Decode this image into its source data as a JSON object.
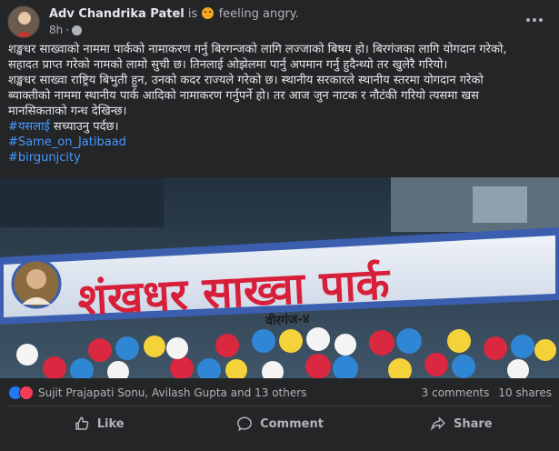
{
  "post": {
    "author": "Adv Chandrika Patel",
    "is_text": "is",
    "feeling_text": "feeling angry.",
    "time": "8h",
    "body_lines": [
      "शङ्खधर साख्वाको नाममा पार्कको नामाकरण गर्नु बिरगन्जको लागि लज्जाको बिषय हो। बिरगंजका लागि योगदान गरेको,",
      "सहादत प्राप्त गरेको नामको लामो सुची छ। तिनलाई ओझेलमा पार्नु अपमान गर्नु हुदैन्थ्यो तर खुलेरै गरियो।",
      "शङ्खधर साख्वा राष्ट्रिय बिभुती हुन, उनको कदर राज्यले गरेको छ। स्थानीय सरकारले स्थानीय स्तरमा योगदान गरेको",
      "ब्याक्तीको नाममा स्थानीय पार्क आदिको नामाकरण गर्नुपर्ने हो। तर आज जुन नाटक र नौटंकी गरियो त्यसमा खस",
      "मानसिकताको गन्ध देखिन्छ।"
    ],
    "hashtag_1": "#यसलाई",
    "hashtag_1_suffix": " सच्याउनु पर्दछ।",
    "hashtag_2": "#Same_on_Jatibaad",
    "hashtag_3": "#birgunjcity"
  },
  "photo": {
    "banner_text": "शंखधर साख्वा पार्क",
    "banner_subtext": "वीरगंज-४"
  },
  "reactions": {
    "names": "Sujit Prajapati Sonu, Avilash Gupta and 13 others",
    "comments": "3 comments",
    "shares": "10 shares"
  },
  "actions": {
    "like": "Like",
    "comment": "Comment",
    "share": "Share"
  },
  "colors": {
    "background": "#242526",
    "text": "#e4e6eb",
    "secondary": "#b0b3b8",
    "hashtag": "#4599ff"
  }
}
